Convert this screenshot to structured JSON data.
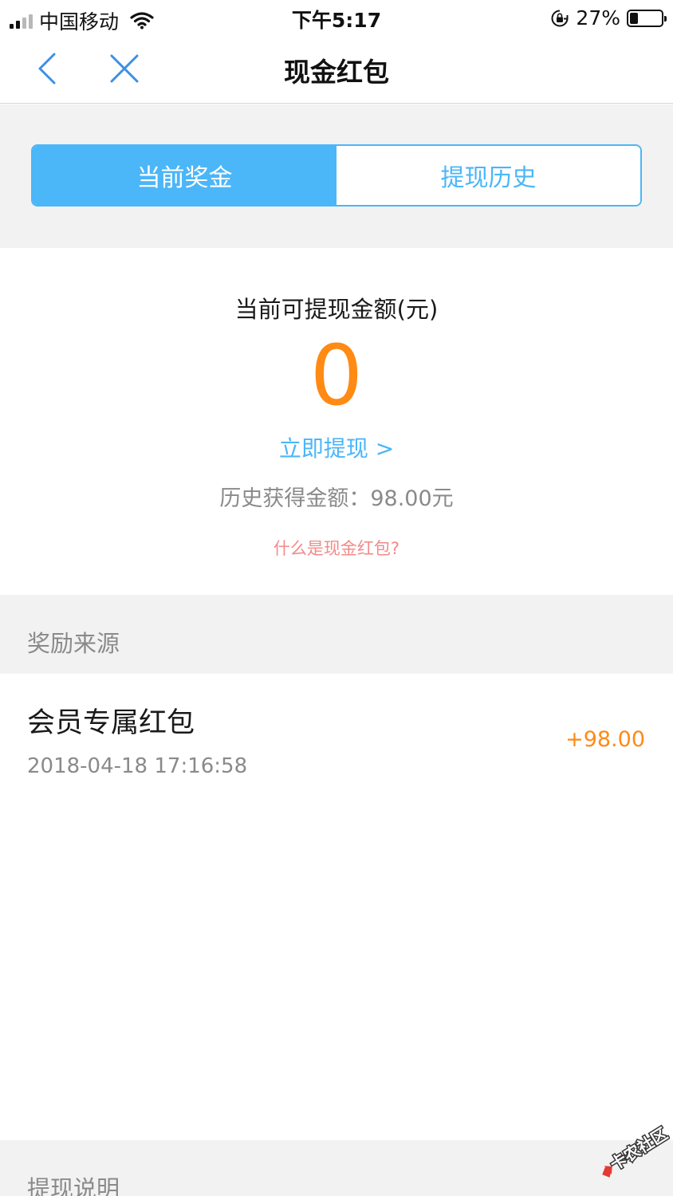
{
  "status_bar": {
    "carrier": "中国移动",
    "time": "下午5:17",
    "battery_percent": "27%",
    "battery_level": 0.27,
    "icons": [
      "signal-icon",
      "wifi-icon",
      "rotation-lock-icon",
      "battery-icon"
    ]
  },
  "nav": {
    "title": "现金红包",
    "icons": [
      "back-chevron-icon",
      "close-icon"
    ]
  },
  "tabs": {
    "current_bonus": "当前奖金",
    "withdraw_history": "提现历史",
    "active_index": 0
  },
  "summary": {
    "label": "当前可提现金额(元)",
    "amount": "0",
    "withdraw_now": "立即提现 >",
    "history_total": "历史获得金额：98.00元",
    "what_is": "什么是现金红包?"
  },
  "source": {
    "header": "奖励来源"
  },
  "records": [
    {
      "title": "会员专属红包",
      "time": "2018-04-18 17:16:58",
      "amount": "+98.00"
    }
  ],
  "footer": {
    "header": "提现说明",
    "watermark_text": "卡农社区"
  },
  "colors": {
    "accent_blue": "#4bb6f8",
    "amount_orange": "#ff8a14",
    "link_pink": "#f28a8a",
    "section_bg": "#f2f2f2"
  }
}
